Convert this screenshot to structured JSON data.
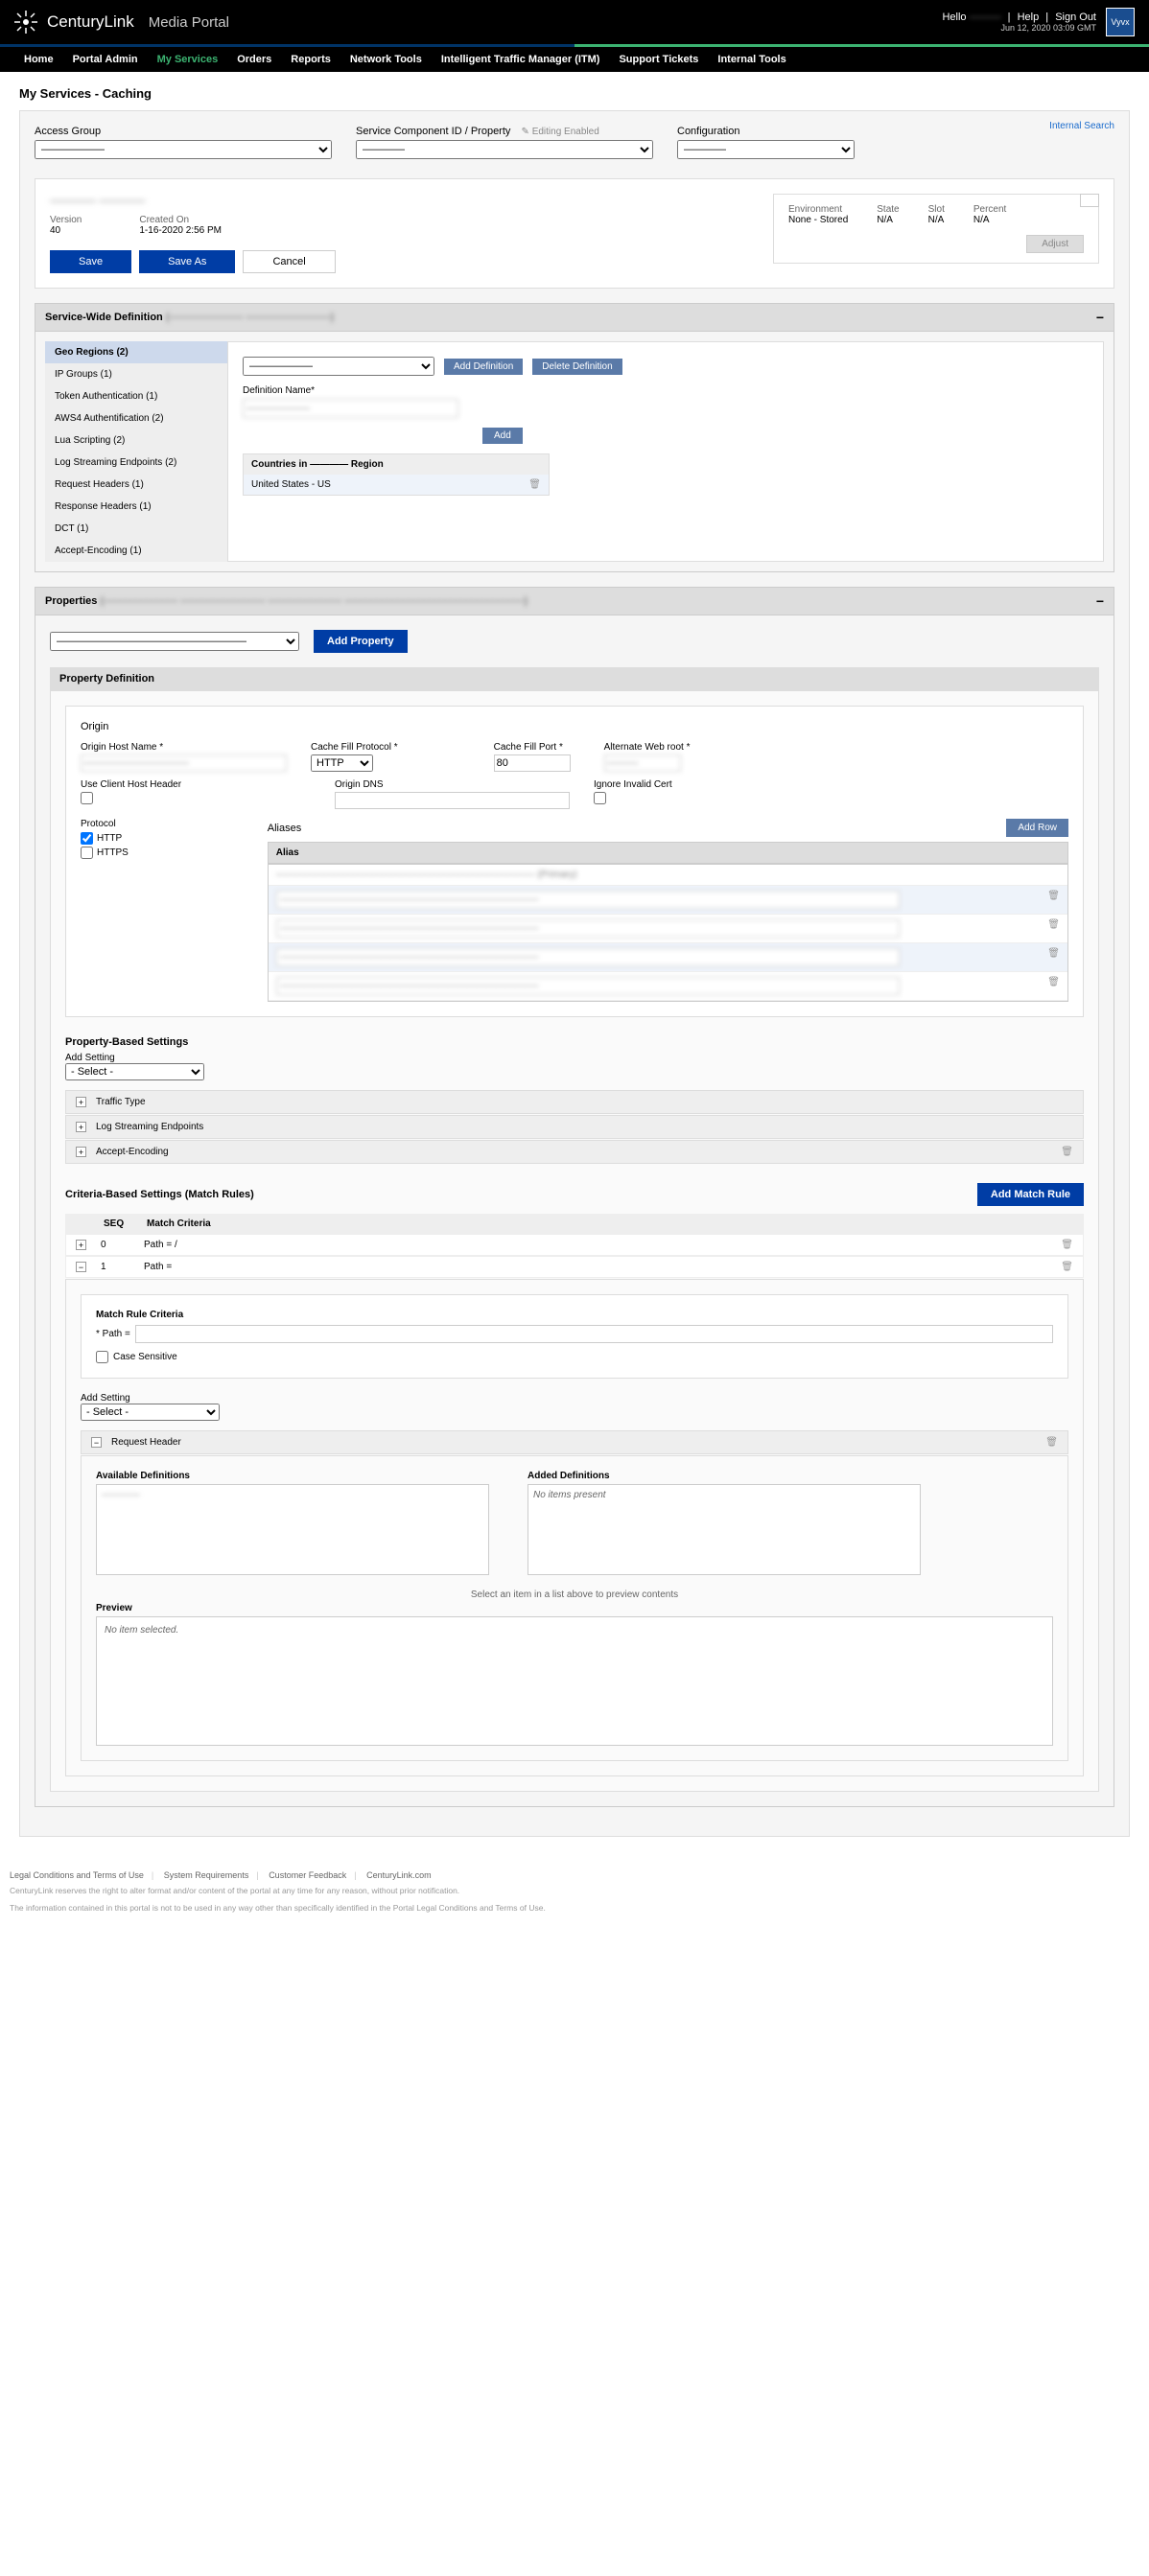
{
  "header": {
    "brand": "CenturyLink",
    "portal": "Media Portal",
    "greeting": "Hello",
    "user": "———",
    "help": "Help",
    "signout": "Sign Out",
    "time": "Jun 12, 2020 03:09 GMT",
    "badge": "Vyvx"
  },
  "nav": {
    "home": "Home",
    "portalAdmin": "Portal Admin",
    "myServices": "My Services",
    "orders": "Orders",
    "reports": "Reports",
    "networkTools": "Network Tools",
    "itm": "Intelligent Traffic Manager (ITM)",
    "supportTickets": "Support Tickets",
    "internalTools": "Internal Tools"
  },
  "page": {
    "title": "My Services - Caching",
    "internalSearch": "Internal Search"
  },
  "filters": {
    "accessGroup": {
      "label": "Access Group",
      "value": "——————"
    },
    "scid": {
      "label": "Service Component ID / Property",
      "editing": "Editing Enabled",
      "value": "————"
    },
    "config": {
      "label": "Configuration",
      "value": "————"
    }
  },
  "configBox": {
    "name": "———— ————",
    "versionLabel": "Version",
    "version": "40",
    "createdLabel": "Created On",
    "created": "1-16-2020 2:56 PM",
    "save": "Save",
    "saveAs": "Save As",
    "cancel": "Cancel",
    "env": {
      "envLabel": "Environment",
      "envVal": "None - Stored",
      "stateLabel": "State",
      "stateVal": "N/A",
      "slotLabel": "Slot",
      "slotVal": "N/A",
      "percentLabel": "Percent",
      "percentVal": "N/A",
      "adjust": "Adjust"
    }
  },
  "swd": {
    "title": "Service-Wide Definition",
    "suffix": "(———————  ————————)",
    "sidebar": {
      "geo": "Geo Regions (2)",
      "ip": "IP Groups (1)",
      "token": "Token Authentication (1)",
      "aws4": "AWS4 Authentification (2)",
      "lua": "Lua Scripting (2)",
      "log": "Log Streaming Endpoints (2)",
      "reqh": "Request Headers (1)",
      "resph": "Response Headers (1)",
      "dct": "DCT (1)",
      "ae": "Accept-Encoding (1)"
    },
    "main": {
      "selValue": "——————",
      "addDef": "Add Definition",
      "delDef": "Delete Definition",
      "defNameLabel": "Definition Name*",
      "defNameVal": "——————",
      "add": "Add",
      "countriesLabel": "Countries in ———— Region",
      "country": "United States - US"
    }
  },
  "props": {
    "title": "Properties",
    "suffix": "(———————  ————————  ———————  —————————————————)",
    "selValue": "——————————————————",
    "addProp": "Add Property",
    "pdTitle": "Property Definition",
    "origin": {
      "title": "Origin",
      "hostLabel": "Origin Host Name *",
      "hostVal": "——————————",
      "cfpLabel": "Cache Fill Protocol *",
      "cfpVal": "HTTP",
      "cfportLabel": "Cache Fill Port *",
      "cfportVal": "80",
      "awrLabel": "Alternate Web root *",
      "awrVal": "———",
      "uchhLabel": "Use Client Host Header",
      "odnsLabel": "Origin DNS",
      "odnsVal": "",
      "iicLabel": "Ignore Invalid Cert",
      "protoLabel": "Protocol",
      "http": "HTTP",
      "https": "HTTPS",
      "aliasesLabel": "Aliases",
      "addRow": "Add Row",
      "aliasCol": "Alias",
      "alias1": "——————————————————————————— (Primary)",
      "alias2": "———————————————————————————",
      "alias3": "———————————————————————————",
      "alias4": "———————————————————————————",
      "alias5": "———————————————————————————"
    },
    "pbs": {
      "title": "Property-Based Settings",
      "addSetting": "Add Setting",
      "selectVal": "- Select -",
      "tt": "Traffic Type",
      "lse": "Log Streaming Endpoints",
      "ae": "Accept-Encoding"
    },
    "cbs": {
      "title": "Criteria-Based Settings (Match Rules)",
      "addMatch": "Add Match Rule",
      "seqCol": "SEQ",
      "mcCol": "Match Criteria",
      "r0seq": "0",
      "r0mc": "Path = /",
      "r1seq": "1",
      "r1mc": "Path =",
      "mrcTitle": "Match Rule Criteria",
      "pathLabel": "* Path =",
      "pathVal": "",
      "csLabel": "Case Sensitive",
      "addSetting2": "Add Setting",
      "selectVal2": "- Select -",
      "reqHeader": "Request Header",
      "availDef": "Available Definitions",
      "availItem": "————",
      "addedDef": "Added Definitions",
      "noItems": "No items present",
      "preview": "Preview",
      "previewHint": "Select an item in a list above to preview contents",
      "noSel": "No item selected."
    }
  },
  "footer": {
    "l1": "Legal Conditions and Terms of Use",
    "l2": "System Requirements",
    "l3": "Customer Feedback",
    "l4": "CenturyLink.com",
    "d1": "CenturyLink reserves the right to alter format and/or content of the portal at any time for any reason, without prior notification.",
    "d2": "The information contained in this portal is not to be used in any way other than specifically identified in the Portal Legal Conditions and Terms of Use."
  }
}
